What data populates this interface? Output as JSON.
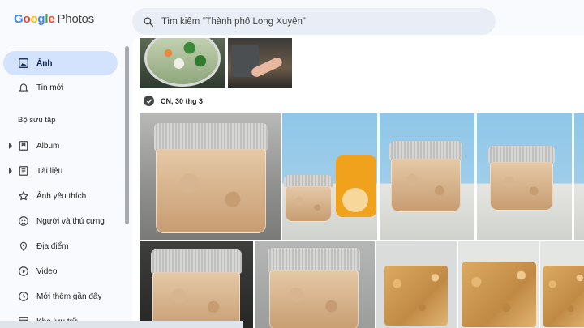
{
  "app": {
    "logo_google": "Google",
    "logo_product": "Photos"
  },
  "search": {
    "placeholder": "Tìm kiếm “Thành phố Long Xuyên”"
  },
  "sidebar": {
    "section_title": "Bộ sưu tập",
    "items": [
      {
        "label": "Ảnh",
        "icon": "photo-icon",
        "active": true
      },
      {
        "label": "Tin mới",
        "icon": "bell-icon"
      },
      {
        "label": "Album",
        "icon": "album-icon",
        "expandable": true
      },
      {
        "label": "Tài liệu",
        "icon": "document-icon",
        "expandable": true
      },
      {
        "label": "Ảnh yêu thích",
        "icon": "star-icon"
      },
      {
        "label": "Người và thú cưng",
        "icon": "face-icon"
      },
      {
        "label": "Địa điểm",
        "icon": "location-pin-icon"
      },
      {
        "label": "Video",
        "icon": "play-icon"
      },
      {
        "label": "Mới thêm gần đây",
        "icon": "clock-icon"
      },
      {
        "label": "Kho lưu trữ",
        "icon": "archive-icon"
      }
    ]
  },
  "main": {
    "date_label": "CN, 30 thg 3"
  },
  "colors": {
    "active_bg": "#d3e3fd",
    "search_bg": "#e9eef6",
    "google_blue": "#4285f4",
    "google_red": "#ea4335",
    "google_yellow": "#fbbc05",
    "google_green": "#34a853"
  }
}
